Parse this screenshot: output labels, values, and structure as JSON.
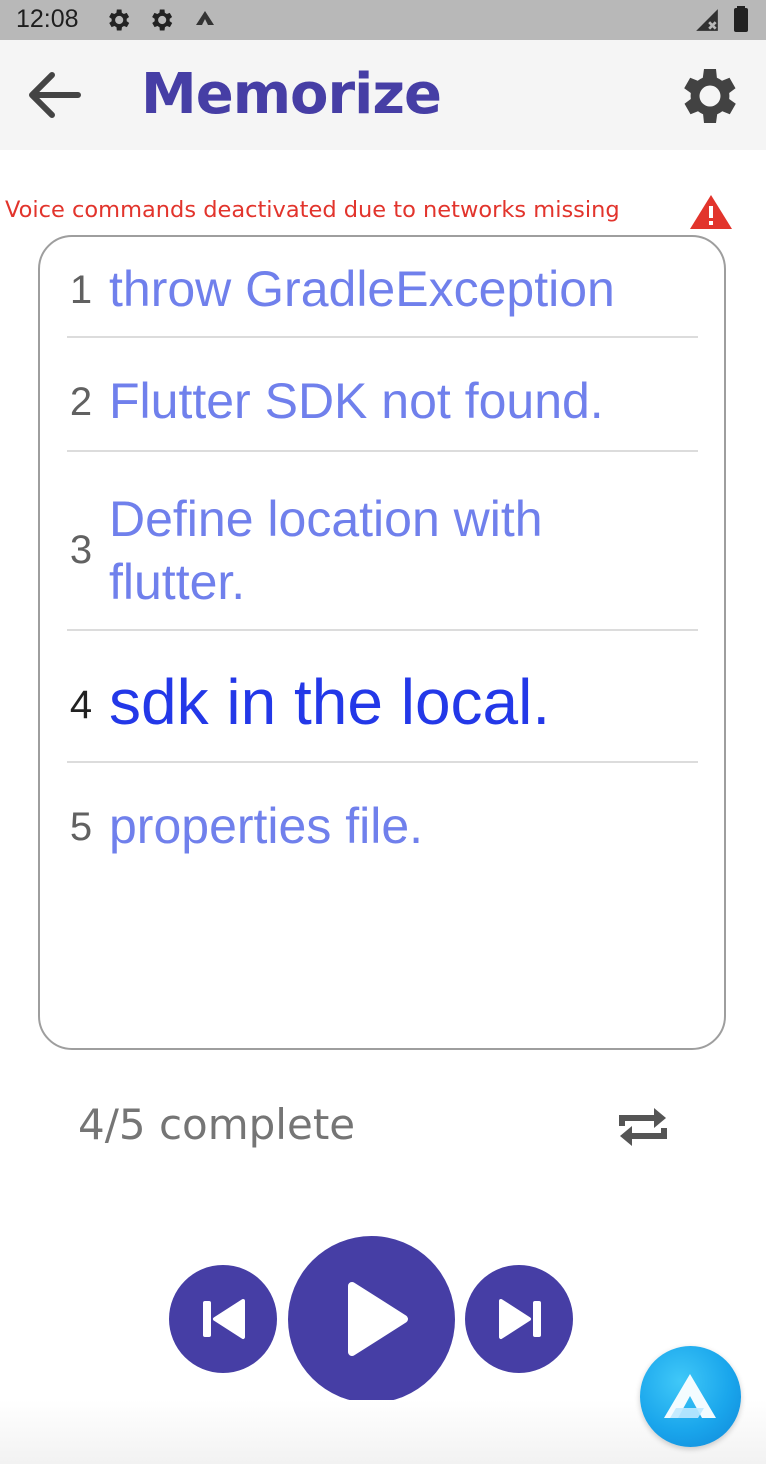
{
  "status_bar": {
    "time": "12:08",
    "icons": [
      "gear-icon",
      "gear-icon",
      "app-notification-icon",
      "signal-icon",
      "battery-icon"
    ]
  },
  "app_bar": {
    "back_icon": "arrow-left-icon",
    "title": "Memorize",
    "settings_icon": "gear-icon"
  },
  "warning": {
    "text": "Voice commands deactivated due to networks missing",
    "icon": "warning-triangle-icon",
    "color": "#e2342c"
  },
  "lines": [
    {
      "number": "1",
      "text": "throw GradleException"
    },
    {
      "number": "2",
      "text": "Flutter SDK not found."
    },
    {
      "number": "3",
      "text": "Define location with flutter."
    },
    {
      "number": "4",
      "text": "sdk in the local."
    },
    {
      "number": "5",
      "text": "properties file."
    }
  ],
  "active_line": 4,
  "progress": {
    "text": "4/5 complete",
    "repeat_icon": "repeat-icon"
  },
  "player": {
    "prev_icon": "skip-previous-icon",
    "play_icon": "play-icon",
    "next_icon": "skip-next-icon"
  },
  "colors": {
    "primary": "#463ea5",
    "line_text": "#7080ec",
    "active_line_text": "#2338e8",
    "warning": "#e2342c",
    "assistant": "#1aa6ec"
  }
}
